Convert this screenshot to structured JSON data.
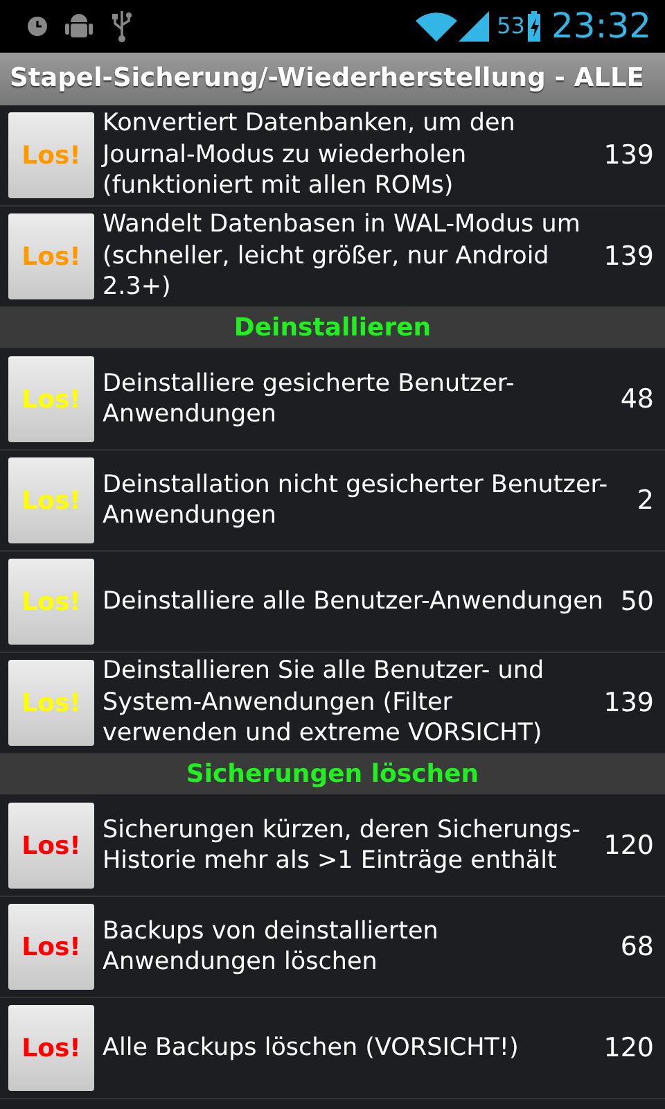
{
  "status_bar": {
    "battery_percent": "53",
    "time": "23:32"
  },
  "title": "Stapel-Sicherung/-Wiederherstellung - ALLE",
  "items": [
    {
      "kind": "row",
      "button": "Los!",
      "color": "#ff9900",
      "text": "Konvertiert Datenbanken, um den Journal-Modus zu wiederholen (funktioniert mit allen ROMs)",
      "count": "139"
    },
    {
      "kind": "row",
      "button": "Los!",
      "color": "#ff9900",
      "text": "Wandelt Datenbasen in WAL-Modus um (schneller, leicht größer, nur Android 2.3+)",
      "count": "139"
    },
    {
      "kind": "header",
      "text": "Deinstallieren"
    },
    {
      "kind": "row",
      "button": "Los!",
      "color": "#ffff00",
      "text": "Deinstalliere gesicherte Benutzer-Anwendungen",
      "count": "48"
    },
    {
      "kind": "row",
      "button": "Los!",
      "color": "#ffff00",
      "text": "Deinstallation nicht gesicherter Benutzer-Anwendungen",
      "count": "2"
    },
    {
      "kind": "row",
      "button": "Los!",
      "color": "#ffff00",
      "text": "Deinstalliere alle Benutzer-Anwendungen",
      "count": "50"
    },
    {
      "kind": "row",
      "button": "Los!",
      "color": "#ffff00",
      "text": "Deinstallieren Sie alle Benutzer- und System-Anwendungen (Filter verwenden und extreme VORSICHT)",
      "count": "139"
    },
    {
      "kind": "header",
      "text": "Sicherungen löschen"
    },
    {
      "kind": "row",
      "button": "Los!",
      "color": "#ff0000",
      "text": "Sicherungen kürzen, deren Sicherungs-Historie mehr als >1 Einträge enthält",
      "count": "120"
    },
    {
      "kind": "row",
      "button": "Los!",
      "color": "#ff0000",
      "text": "Backups von deinstallierten Anwendungen löschen",
      "count": "68"
    },
    {
      "kind": "row",
      "button": "Los!",
      "color": "#ff0000",
      "text": "Alle Backups löschen (VORSICHT!)",
      "count": "120"
    }
  ]
}
